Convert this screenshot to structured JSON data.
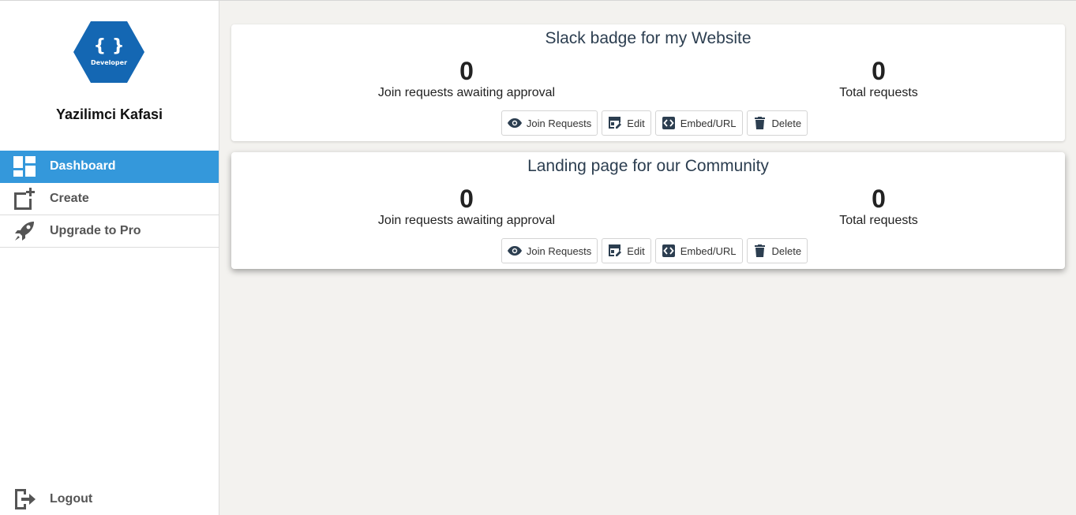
{
  "sidebar": {
    "logo": {
      "glyph": "{ }",
      "caption": "Developer",
      "color": "#1467b3"
    },
    "org_name": "Yazilimci Kafasi",
    "items": [
      {
        "label": "Dashboard",
        "icon": "dashboard-icon",
        "active": true
      },
      {
        "label": "Create",
        "icon": "add-box-icon",
        "active": false
      },
      {
        "label": "Upgrade to Pro",
        "icon": "rocket-icon",
        "active": false
      }
    ],
    "logout_label": "Logout"
  },
  "cards": [
    {
      "title": "Slack badge for my Website",
      "pending_count": "0",
      "pending_label": "Join requests awaiting approval",
      "total_count": "0",
      "total_label": "Total requests",
      "buttons": {
        "join": "Join Requests",
        "edit": "Edit",
        "embed": "Embed/URL",
        "delete": "Delete"
      }
    },
    {
      "title": "Landing page for our Community",
      "pending_count": "0",
      "pending_label": "Join requests awaiting approval",
      "total_count": "0",
      "total_label": "Total requests",
      "buttons": {
        "join": "Join Requests",
        "edit": "Edit",
        "embed": "Embed/URL",
        "delete": "Delete"
      }
    }
  ],
  "colors": {
    "accent": "#3498db",
    "icon_dark": "#2c3e50",
    "background": "#f3f2ef"
  }
}
